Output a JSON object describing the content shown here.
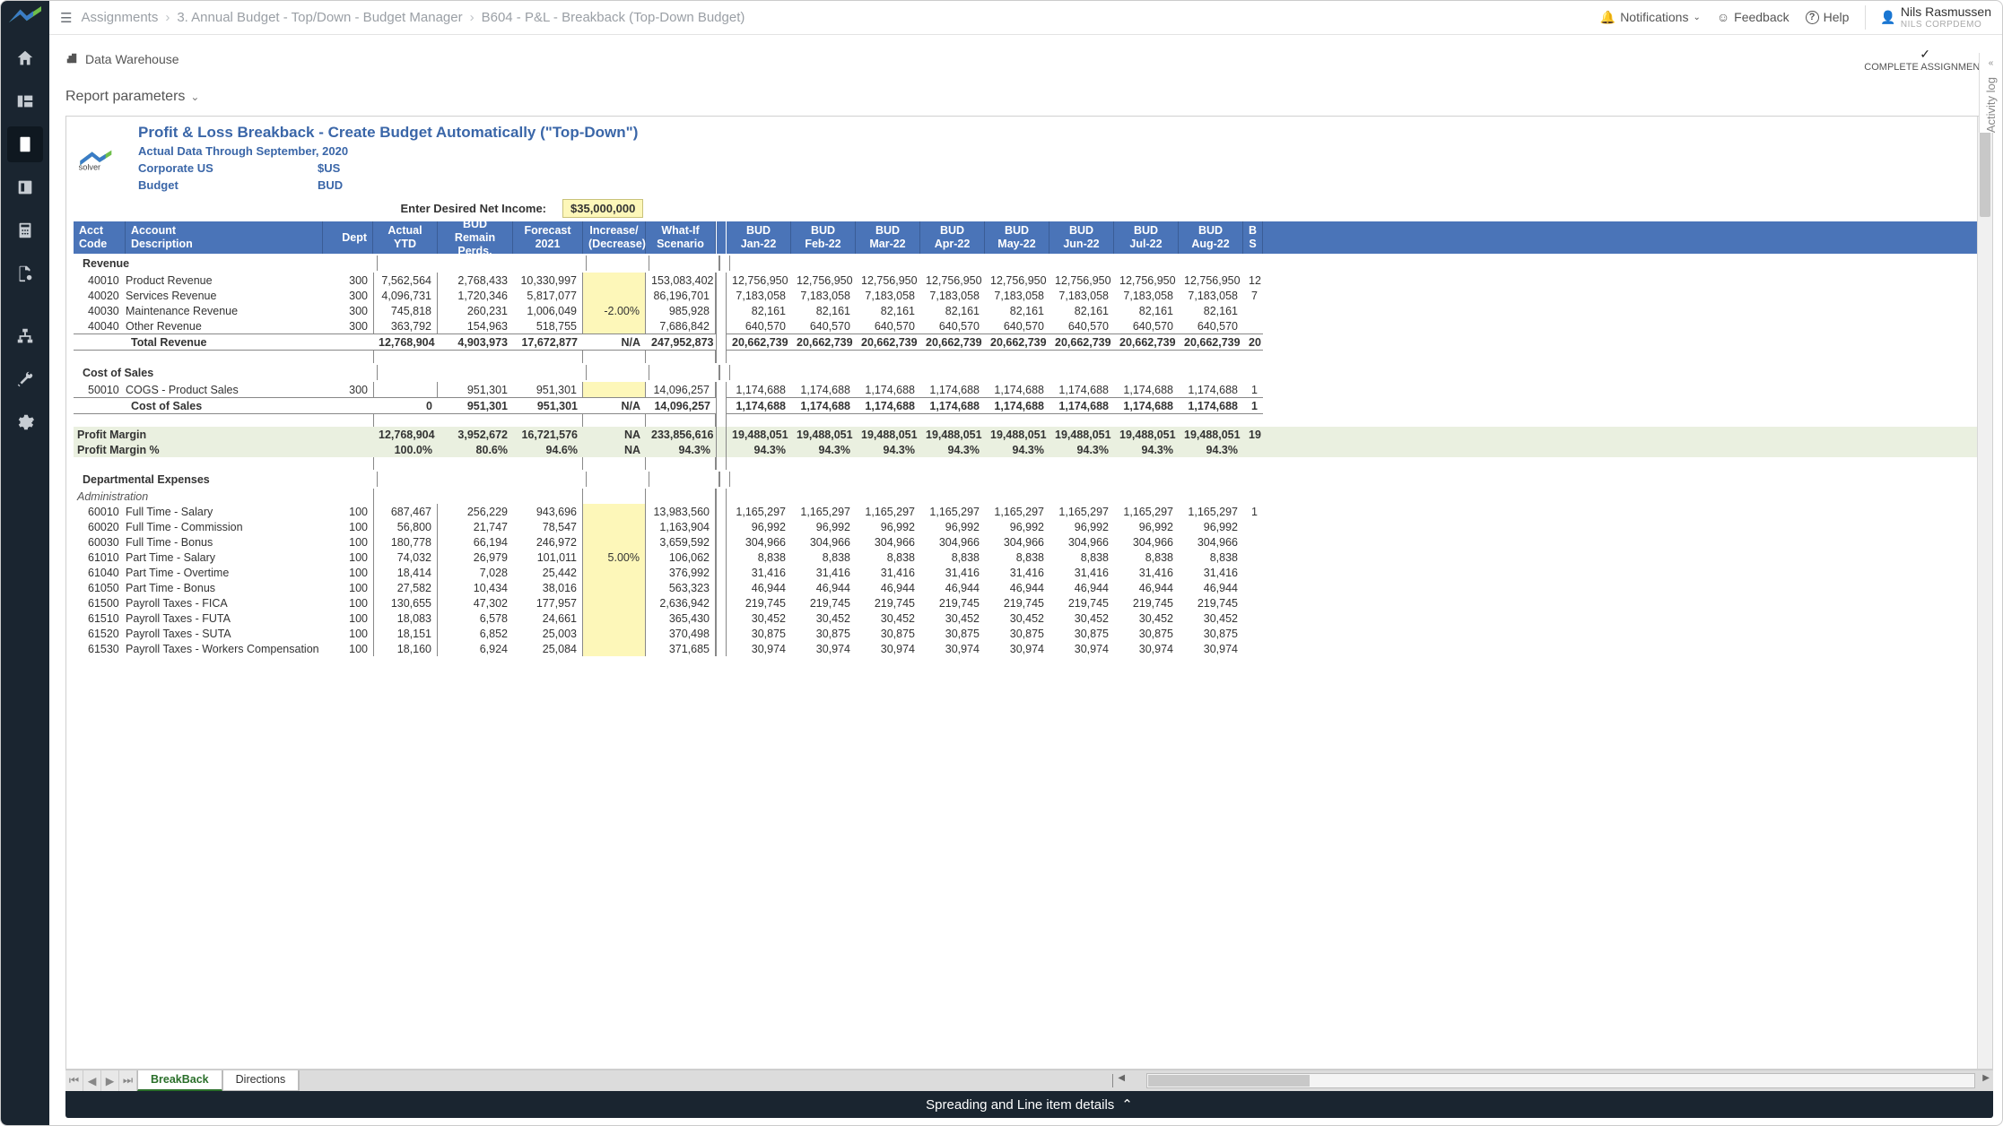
{
  "breadcrumbs": [
    "Assignments",
    "3. Annual Budget - Top/Down - Budget Manager",
    "B604 - P&L - Breakback (Top-Down Budget)"
  ],
  "topbar": {
    "notifications": "Notifications",
    "feedback": "Feedback",
    "help": "Help",
    "user_name": "Nils Rasmussen",
    "user_org": "Nils CorpDemo"
  },
  "actionbar": {
    "data_warehouse": "Data Warehouse",
    "complete": "COMPLETE ASSIGNMENT"
  },
  "params_label": "Report parameters",
  "activity_log": "Activity log",
  "bottom_bar": "Spreading and Line item details",
  "sheet_tabs": {
    "active": "BreakBack",
    "other": "Directions"
  },
  "report": {
    "title": "Profit & Loss Breakback - Create Budget Automatically (\"Top-Down\")",
    "subtitle": "Actual Data Through September, 2020",
    "kv": [
      {
        "k": "Corporate US",
        "v": "$US"
      },
      {
        "k": "Budget",
        "v": "BUD"
      }
    ],
    "net_income_label": "Enter Desired Net Income:",
    "net_income_value": "$35,000,000",
    "logo_text": "solver"
  },
  "columns": {
    "acct": [
      "Acct",
      "Code"
    ],
    "desc": [
      "Account",
      "Description"
    ],
    "dept": [
      "",
      "Dept"
    ],
    "ytd": [
      "Actual",
      "YTD"
    ],
    "bud_rp": [
      "BUD",
      "Remain Perds."
    ],
    "fc": [
      "Forecast",
      "2021"
    ],
    "inc": [
      "Increase/",
      "(Decrease)"
    ],
    "wi": [
      "What-If",
      "Scenario"
    ],
    "months": [
      "Jan-22",
      "Feb-22",
      "Mar-22",
      "Apr-22",
      "May-22",
      "Jun-22",
      "Jul-22",
      "Aug-22"
    ],
    "month_top": "BUD",
    "last_top": "B",
    "last_bot": "S"
  },
  "sections": {
    "revenue": "Revenue",
    "cost_of_sales": "Cost of Sales",
    "cost_of_sales_total": "Cost of Sales",
    "profit_margin": "Profit Margin",
    "profit_margin_pct": "Profit Margin %",
    "dept_exp": "Departmental Expenses",
    "admin": "Administration",
    "total_revenue": "Total Revenue"
  },
  "rows": {
    "revenue": [
      {
        "acct": "40010",
        "desc": "Product Revenue",
        "dept": "300",
        "ytd": "7,562,564",
        "budrp": "2,768,433",
        "fc": "10,330,997",
        "inc": "",
        "wi": "153,083,402",
        "m": "12,756,950",
        "last": "12"
      },
      {
        "acct": "40020",
        "desc": "Services Revenue",
        "dept": "300",
        "ytd": "4,096,731",
        "budrp": "1,720,346",
        "fc": "5,817,077",
        "inc": "",
        "wi": "86,196,701",
        "m": "7,183,058",
        "last": "7"
      },
      {
        "acct": "40030",
        "desc": "Maintenance Revenue",
        "dept": "300",
        "ytd": "745,818",
        "budrp": "260,231",
        "fc": "1,006,049",
        "inc": "-2.00%",
        "wi": "985,928",
        "m": "82,161",
        "last": ""
      },
      {
        "acct": "40040",
        "desc": "Other Revenue",
        "dept": "300",
        "ytd": "363,792",
        "budrp": "154,963",
        "fc": "518,755",
        "inc": "",
        "wi": "7,686,842",
        "m": "640,570",
        "last": ""
      }
    ],
    "total_revenue": {
      "ytd": "12,768,904",
      "budrp": "4,903,973",
      "fc": "17,672,877",
      "inc": "N/A",
      "wi": "247,952,873",
      "m": "20,662,739",
      "last": "20"
    },
    "cogs": [
      {
        "acct": "50010",
        "desc": "COGS - Product Sales",
        "dept": "300",
        "ytd": "",
        "budrp": "951,301",
        "fc": "951,301",
        "inc": "",
        "wi": "14,096,257",
        "m": "1,174,688",
        "last": "1"
      }
    ],
    "cost_of_sales_total": {
      "ytd": "0",
      "budrp": "951,301",
      "fc": "951,301",
      "inc": "N/A",
      "wi": "14,096,257",
      "m": "1,174,688",
      "last": "1"
    },
    "profit_margin": {
      "ytd": "12,768,904",
      "budrp": "3,952,672",
      "fc": "16,721,576",
      "inc": "NA",
      "wi": "233,856,616",
      "m": "19,488,051",
      "last": "19"
    },
    "profit_margin_pct": {
      "ytd": "100.0%",
      "budrp": "80.6%",
      "fc": "94.6%",
      "inc": "NA",
      "wi": "94.3%",
      "m": "94.3%",
      "last": ""
    },
    "admin": [
      {
        "acct": "60010",
        "desc": "Full Time - Salary",
        "dept": "100",
        "ytd": "687,467",
        "budrp": "256,229",
        "fc": "943,696",
        "inc": "",
        "wi": "13,983,560",
        "m": "1,165,297",
        "last": "1"
      },
      {
        "acct": "60020",
        "desc": "Full Time - Commission",
        "dept": "100",
        "ytd": "56,800",
        "budrp": "21,747",
        "fc": "78,547",
        "inc": "",
        "wi": "1,163,904",
        "m": "96,992",
        "last": ""
      },
      {
        "acct": "60030",
        "desc": "Full Time - Bonus",
        "dept": "100",
        "ytd": "180,778",
        "budrp": "66,194",
        "fc": "246,972",
        "inc": "",
        "wi": "3,659,592",
        "m": "304,966",
        "last": ""
      },
      {
        "acct": "61010",
        "desc": "Part Time - Salary",
        "dept": "100",
        "ytd": "74,032",
        "budrp": "26,979",
        "fc": "101,011",
        "inc": "5.00%",
        "wi": "106,062",
        "m": "8,838",
        "last": ""
      },
      {
        "acct": "61040",
        "desc": "Part Time - Overtime",
        "dept": "100",
        "ytd": "18,414",
        "budrp": "7,028",
        "fc": "25,442",
        "inc": "",
        "wi": "376,992",
        "m": "31,416",
        "last": ""
      },
      {
        "acct": "61050",
        "desc": "Part Time - Bonus",
        "dept": "100",
        "ytd": "27,582",
        "budrp": "10,434",
        "fc": "38,016",
        "inc": "",
        "wi": "563,323",
        "m": "46,944",
        "last": ""
      },
      {
        "acct": "61500",
        "desc": "Payroll Taxes - FICA",
        "dept": "100",
        "ytd": "130,655",
        "budrp": "47,302",
        "fc": "177,957",
        "inc": "",
        "wi": "2,636,942",
        "m": "219,745",
        "last": ""
      },
      {
        "acct": "61510",
        "desc": "Payroll Taxes - FUTA",
        "dept": "100",
        "ytd": "18,083",
        "budrp": "6,578",
        "fc": "24,661",
        "inc": "",
        "wi": "365,430",
        "m": "30,452",
        "last": ""
      },
      {
        "acct": "61520",
        "desc": "Payroll Taxes - SUTA",
        "dept": "100",
        "ytd": "18,151",
        "budrp": "6,852",
        "fc": "25,003",
        "inc": "",
        "wi": "370,498",
        "m": "30,875",
        "last": ""
      },
      {
        "acct": "61530",
        "desc": "Payroll Taxes - Workers Compensation",
        "dept": "100",
        "ytd": "18,160",
        "budrp": "6,924",
        "fc": "25,084",
        "inc": "",
        "wi": "371,685",
        "m": "30,974",
        "last": ""
      }
    ]
  }
}
